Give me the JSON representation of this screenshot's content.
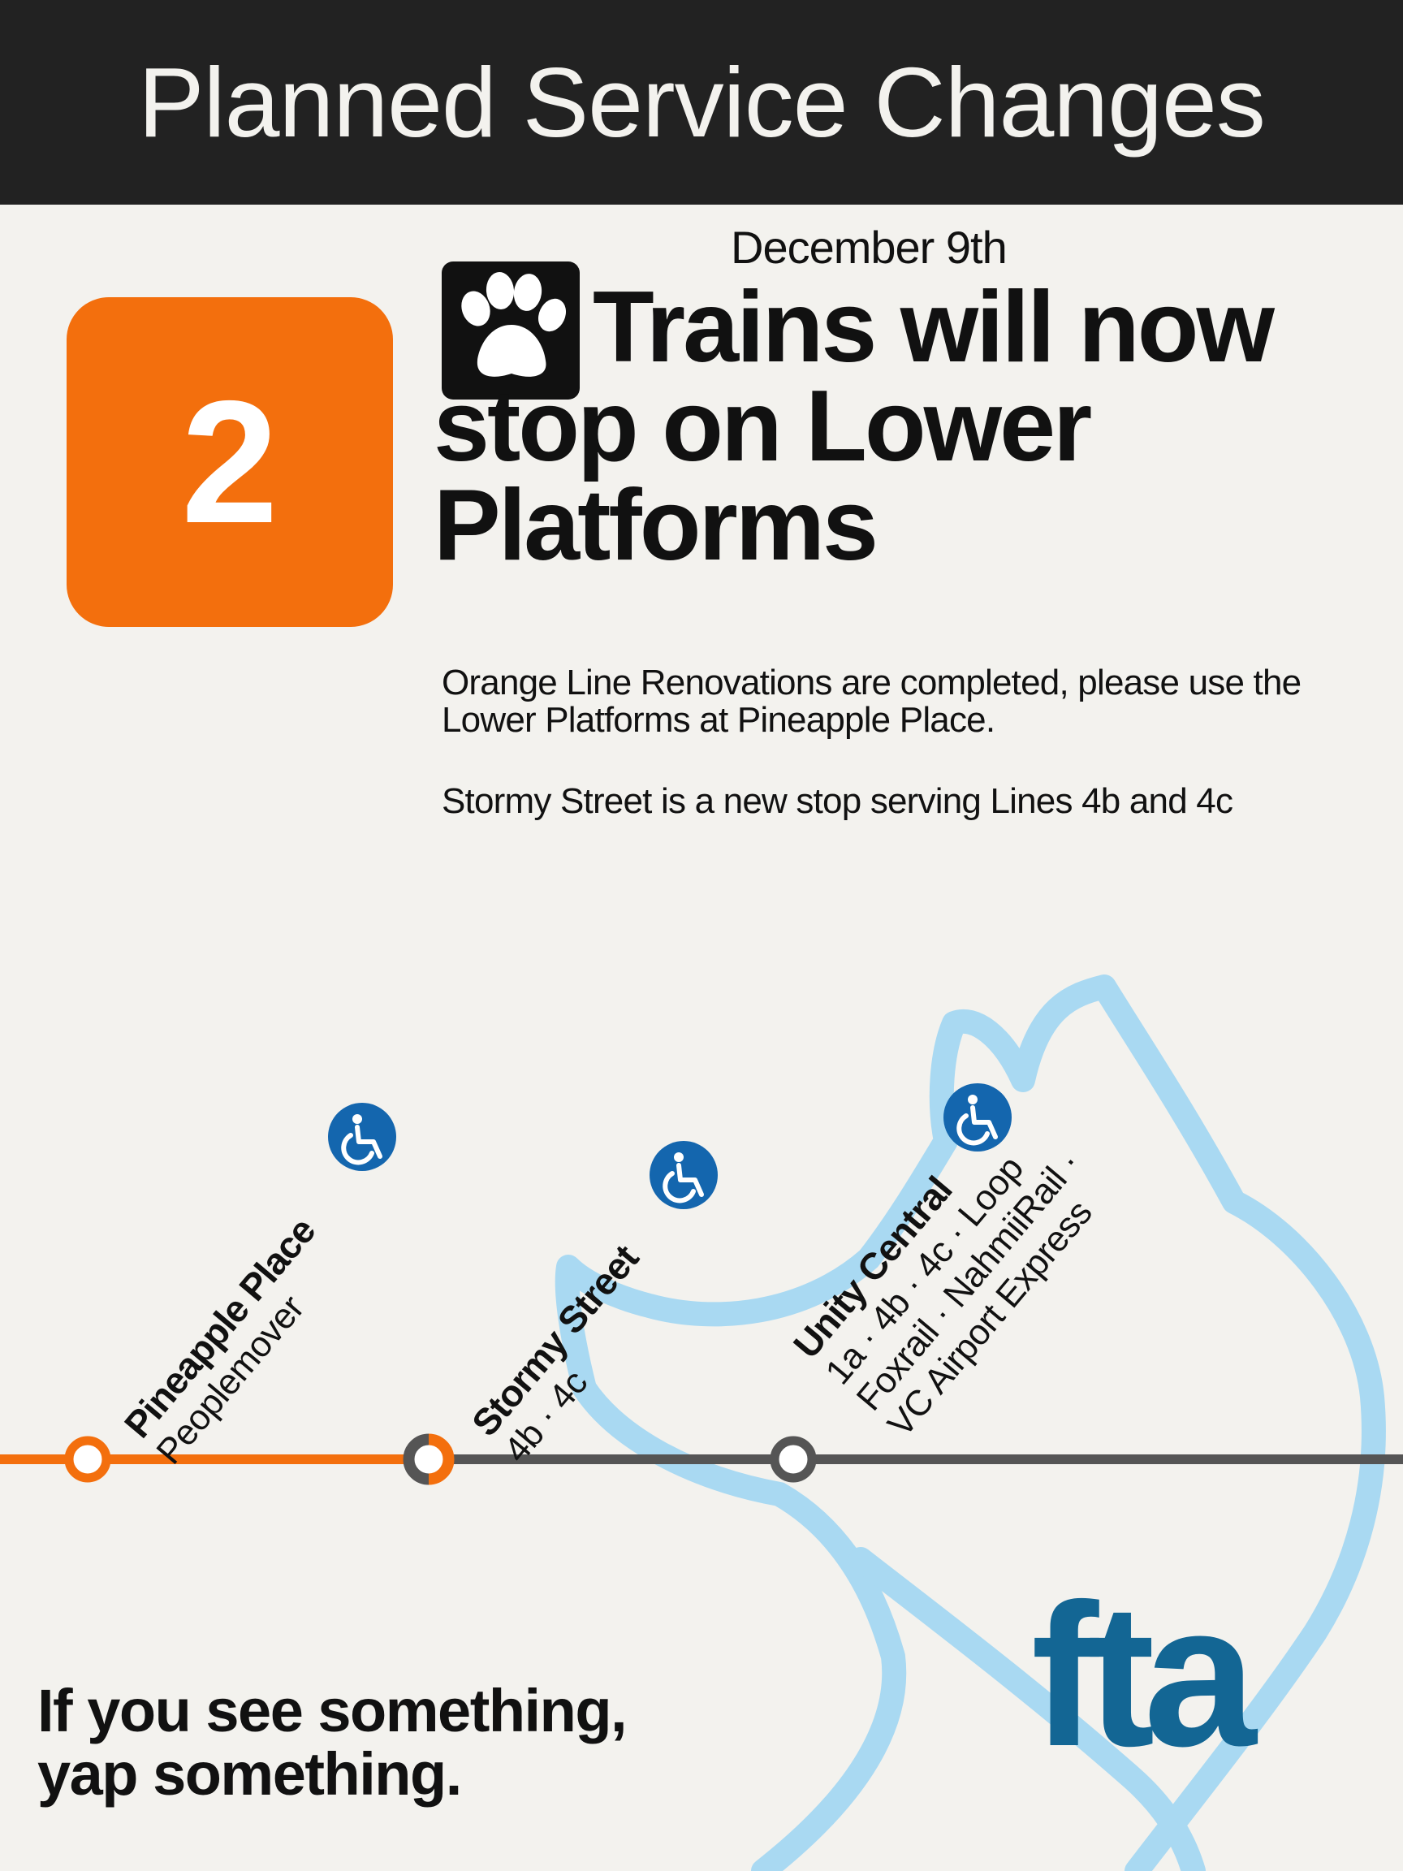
{
  "header": {
    "title": "Planned Service Changes"
  },
  "notice": {
    "date": "December 9th",
    "line_number": "2",
    "headline_line1": "Trains will now",
    "headline_line2": "stop on Lower",
    "headline_line3": "Platforms",
    "paragraph1": "Orange Line Renovations are completed, please use the Lower Platforms at Pineapple Place.",
    "paragraph2": "Stormy Street is a new stop serving Lines 4b and 4c"
  },
  "stations": [
    {
      "name": "Pineapple Place",
      "lines": [
        "Peoplemover"
      ],
      "accessible": true
    },
    {
      "name": "Stormy Street",
      "lines": [
        "4b · 4c"
      ],
      "accessible": true
    },
    {
      "name": "Unity Central",
      "lines": [
        "1a · 4b · 4c · Loop",
        "Foxrail · NahmiiRail ·",
        "VC Airport Express"
      ],
      "accessible": true
    }
  ],
  "footer": {
    "slogan_line1": "If you see something,",
    "slogan_line2": "yap something.",
    "logo": "fta"
  },
  "colors": {
    "orange_line": "#f36f0d",
    "grey_line": "#555555",
    "header_bg": "#222222",
    "accessibility_blue": "#1466ae",
    "fox_outline": "#a9d9f2",
    "logo_blue": "#136694"
  },
  "icons": [
    "paw-icon",
    "wheelchair-icon"
  ]
}
